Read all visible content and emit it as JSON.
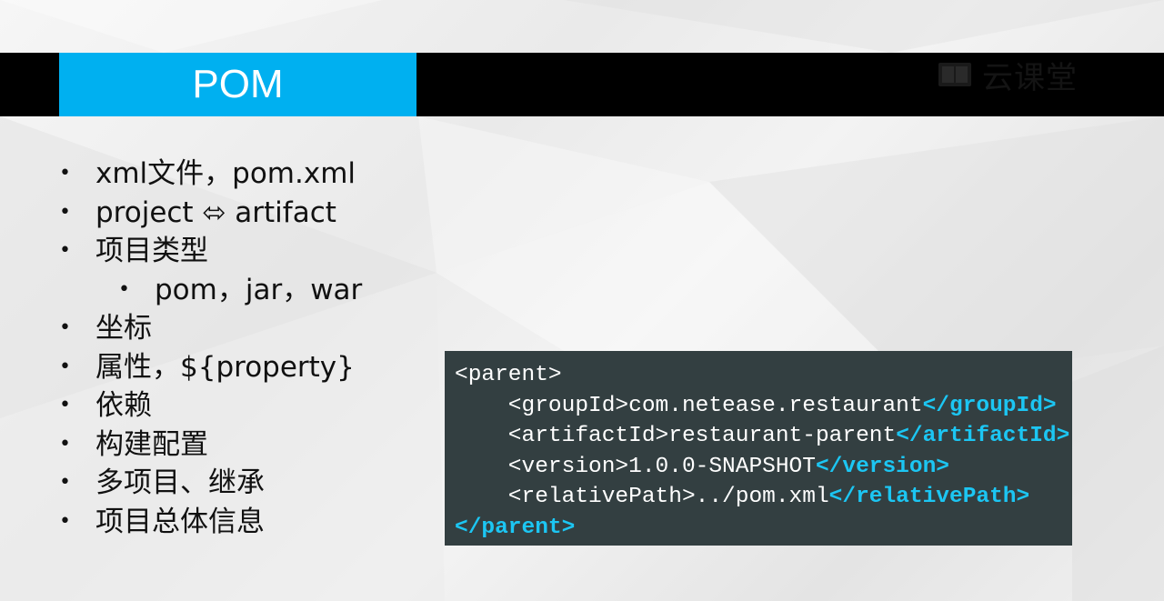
{
  "slide": {
    "title": "POM",
    "logo_text": "云课堂",
    "bullets": [
      {
        "text": "xml文件，pom.xml",
        "level": 1
      },
      {
        "text": "project ⬄ artifact",
        "level": 1
      },
      {
        "text": "项目类型",
        "level": 1
      },
      {
        "text": "pom，jar，war",
        "level": 2
      },
      {
        "text": "坐标",
        "level": 1
      },
      {
        "text": "属性，${property}",
        "level": 1
      },
      {
        "text": "依赖",
        "level": 1
      },
      {
        "text": "构建配置",
        "level": 1
      },
      {
        "text": "多项目、继承",
        "level": 1
      },
      {
        "text": "项目总体信息",
        "level": 1
      }
    ]
  },
  "code": {
    "line1_open": "<parent>",
    "line2_open": "    <groupId>com.netease.restaurant",
    "line2_close": "</groupId>",
    "line3_open": "    <artifactId>restaurant-parent",
    "line3_close": "</artifactId>",
    "line4_open": "    <version>1.0.0-SNAPSHOT",
    "line4_close": "</version>",
    "line5_open": "    <relativePath>../pom.xml",
    "line5_close": "</relativePath>",
    "line6_close": "</parent>"
  },
  "colors": {
    "title_bg": "#00b0f0",
    "bar_bg": "#000000",
    "code_bg": "#333f41",
    "code_keyword": "#1cc6f3"
  },
  "icons": {
    "logo": "book-icon"
  }
}
